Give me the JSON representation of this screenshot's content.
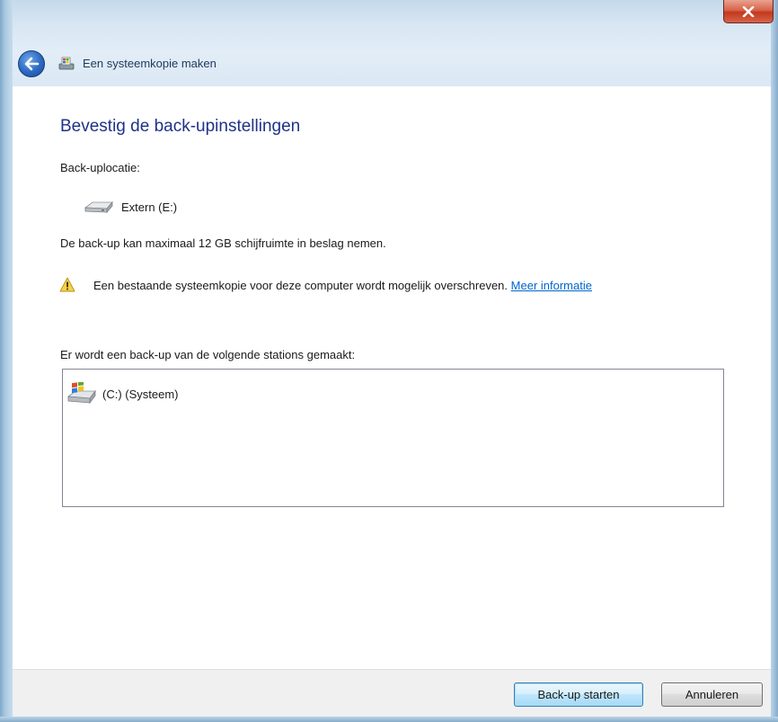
{
  "window": {
    "title": "Een systeemkopie maken"
  },
  "heading": "Bevestig de back-upinstellingen",
  "location": {
    "label": "Back-uplocatie:",
    "drive_name": "Extern (E:)",
    "drive_icon": "external-drive-icon"
  },
  "space_note": "De back-up kan maximaal 12 GB schijfruimte in beslag nemen.",
  "warning": {
    "icon": "warning-icon",
    "text": "Een bestaande systeemkopie voor deze computer wordt mogelijk overschreven.",
    "link_text": "Meer informatie"
  },
  "stations": {
    "label": "Er wordt een back-up van de volgende stations gemaakt:",
    "items": [
      {
        "name": "(C:) (Systeem)",
        "icon": "windows-drive-icon"
      }
    ]
  },
  "buttons": {
    "start": "Back-up starten",
    "cancel": "Annuleren"
  },
  "colors": {
    "heading": "#1e3287",
    "link": "#0066cc",
    "close_button": "#c2391d"
  }
}
